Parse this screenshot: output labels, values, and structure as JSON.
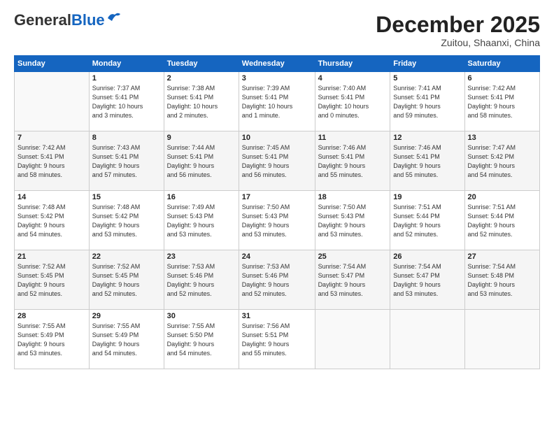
{
  "header": {
    "logo_general": "General",
    "logo_blue": "Blue",
    "month": "December 2025",
    "location": "Zuitou, Shaanxi, China"
  },
  "weekdays": [
    "Sunday",
    "Monday",
    "Tuesday",
    "Wednesday",
    "Thursday",
    "Friday",
    "Saturday"
  ],
  "weeks": [
    [
      {
        "day": "",
        "info": ""
      },
      {
        "day": "1",
        "info": "Sunrise: 7:37 AM\nSunset: 5:41 PM\nDaylight: 10 hours\nand 3 minutes."
      },
      {
        "day": "2",
        "info": "Sunrise: 7:38 AM\nSunset: 5:41 PM\nDaylight: 10 hours\nand 2 minutes."
      },
      {
        "day": "3",
        "info": "Sunrise: 7:39 AM\nSunset: 5:41 PM\nDaylight: 10 hours\nand 1 minute."
      },
      {
        "day": "4",
        "info": "Sunrise: 7:40 AM\nSunset: 5:41 PM\nDaylight: 10 hours\nand 0 minutes."
      },
      {
        "day": "5",
        "info": "Sunrise: 7:41 AM\nSunset: 5:41 PM\nDaylight: 9 hours\nand 59 minutes."
      },
      {
        "day": "6",
        "info": "Sunrise: 7:42 AM\nSunset: 5:41 PM\nDaylight: 9 hours\nand 58 minutes."
      }
    ],
    [
      {
        "day": "7",
        "info": "Sunrise: 7:42 AM\nSunset: 5:41 PM\nDaylight: 9 hours\nand 58 minutes."
      },
      {
        "day": "8",
        "info": "Sunrise: 7:43 AM\nSunset: 5:41 PM\nDaylight: 9 hours\nand 57 minutes."
      },
      {
        "day": "9",
        "info": "Sunrise: 7:44 AM\nSunset: 5:41 PM\nDaylight: 9 hours\nand 56 minutes."
      },
      {
        "day": "10",
        "info": "Sunrise: 7:45 AM\nSunset: 5:41 PM\nDaylight: 9 hours\nand 56 minutes."
      },
      {
        "day": "11",
        "info": "Sunrise: 7:46 AM\nSunset: 5:41 PM\nDaylight: 9 hours\nand 55 minutes."
      },
      {
        "day": "12",
        "info": "Sunrise: 7:46 AM\nSunset: 5:41 PM\nDaylight: 9 hours\nand 55 minutes."
      },
      {
        "day": "13",
        "info": "Sunrise: 7:47 AM\nSunset: 5:42 PM\nDaylight: 9 hours\nand 54 minutes."
      }
    ],
    [
      {
        "day": "14",
        "info": "Sunrise: 7:48 AM\nSunset: 5:42 PM\nDaylight: 9 hours\nand 54 minutes."
      },
      {
        "day": "15",
        "info": "Sunrise: 7:48 AM\nSunset: 5:42 PM\nDaylight: 9 hours\nand 53 minutes."
      },
      {
        "day": "16",
        "info": "Sunrise: 7:49 AM\nSunset: 5:43 PM\nDaylight: 9 hours\nand 53 minutes."
      },
      {
        "day": "17",
        "info": "Sunrise: 7:50 AM\nSunset: 5:43 PM\nDaylight: 9 hours\nand 53 minutes."
      },
      {
        "day": "18",
        "info": "Sunrise: 7:50 AM\nSunset: 5:43 PM\nDaylight: 9 hours\nand 53 minutes."
      },
      {
        "day": "19",
        "info": "Sunrise: 7:51 AM\nSunset: 5:44 PM\nDaylight: 9 hours\nand 52 minutes."
      },
      {
        "day": "20",
        "info": "Sunrise: 7:51 AM\nSunset: 5:44 PM\nDaylight: 9 hours\nand 52 minutes."
      }
    ],
    [
      {
        "day": "21",
        "info": "Sunrise: 7:52 AM\nSunset: 5:45 PM\nDaylight: 9 hours\nand 52 minutes."
      },
      {
        "day": "22",
        "info": "Sunrise: 7:52 AM\nSunset: 5:45 PM\nDaylight: 9 hours\nand 52 minutes."
      },
      {
        "day": "23",
        "info": "Sunrise: 7:53 AM\nSunset: 5:46 PM\nDaylight: 9 hours\nand 52 minutes."
      },
      {
        "day": "24",
        "info": "Sunrise: 7:53 AM\nSunset: 5:46 PM\nDaylight: 9 hours\nand 52 minutes."
      },
      {
        "day": "25",
        "info": "Sunrise: 7:54 AM\nSunset: 5:47 PM\nDaylight: 9 hours\nand 53 minutes."
      },
      {
        "day": "26",
        "info": "Sunrise: 7:54 AM\nSunset: 5:47 PM\nDaylight: 9 hours\nand 53 minutes."
      },
      {
        "day": "27",
        "info": "Sunrise: 7:54 AM\nSunset: 5:48 PM\nDaylight: 9 hours\nand 53 minutes."
      }
    ],
    [
      {
        "day": "28",
        "info": "Sunrise: 7:55 AM\nSunset: 5:49 PM\nDaylight: 9 hours\nand 53 minutes."
      },
      {
        "day": "29",
        "info": "Sunrise: 7:55 AM\nSunset: 5:49 PM\nDaylight: 9 hours\nand 54 minutes."
      },
      {
        "day": "30",
        "info": "Sunrise: 7:55 AM\nSunset: 5:50 PM\nDaylight: 9 hours\nand 54 minutes."
      },
      {
        "day": "31",
        "info": "Sunrise: 7:56 AM\nSunset: 5:51 PM\nDaylight: 9 hours\nand 55 minutes."
      },
      {
        "day": "",
        "info": ""
      },
      {
        "day": "",
        "info": ""
      },
      {
        "day": "",
        "info": ""
      }
    ]
  ]
}
